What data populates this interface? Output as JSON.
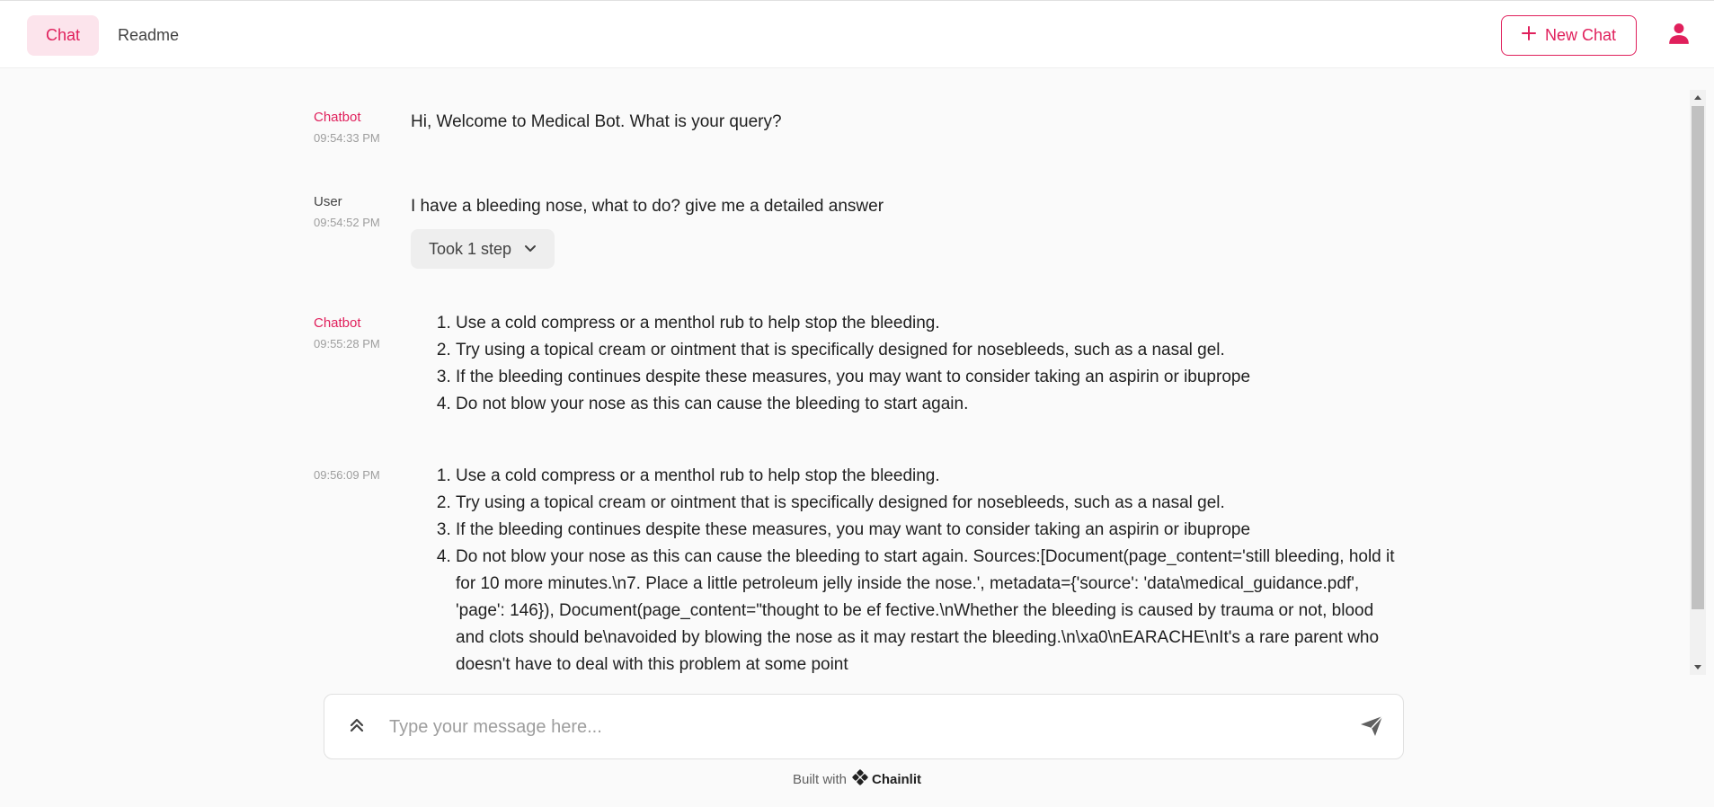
{
  "header": {
    "tabs": [
      {
        "label": "Chat",
        "active": true
      },
      {
        "label": "Readme",
        "active": false
      }
    ],
    "new_chat_label": "New Chat",
    "accent_color": "#e0205c"
  },
  "messages": [
    {
      "author": "Chatbot",
      "time": "09:54:33 PM",
      "text": "Hi, Welcome to Medical Bot. What is your query?"
    },
    {
      "author": "User",
      "time": "09:54:52 PM",
      "text": "I have a bleeding nose, what to do? give me a detailed answer",
      "steps_label": "Took 1 step"
    },
    {
      "author": "Chatbot",
      "time": "09:55:28 PM",
      "items": [
        "Use a cold compress or a menthol rub to help stop the bleeding.",
        "Try using a topical cream or ointment that is specifically designed for nosebleeds, such as a nasal gel.",
        "If the bleeding continues despite these measures, you may want to consider taking an aspirin or ibuprope",
        "Do not blow your nose as this can cause the bleeding to start again."
      ]
    },
    {
      "author": "",
      "time": "09:56:09 PM",
      "items": [
        "Use a cold compress or a menthol rub to help stop the bleeding.",
        "Try using a topical cream or ointment that is specifically designed for nosebleeds, such as a nasal gel.",
        "If the bleeding continues despite these measures, you may want to consider taking an aspirin or ibuprope",
        "Do not blow your nose as this can cause the bleeding to start again. Sources:[Document(page_content='still bleeding, hold it for 10 more minutes.\\n7. Place a little petroleum jelly inside the nose.', metadata={'source': 'data\\medical_guidance.pdf', 'page': 146}), Document(page_content=\"thought to be ef fective.\\nWhether the bleeding is caused by trauma or not, blood and clots should be\\navoided by blowing the nose as it may restart the bleeding.\\n\\xa0\\nEARACHE\\nIt's a rare parent who doesn't have to deal with this problem at some point"
      ]
    }
  ],
  "composer": {
    "placeholder": "Type your message here..."
  },
  "footer": {
    "built_with": "Built with",
    "brand": "Chainlit"
  }
}
